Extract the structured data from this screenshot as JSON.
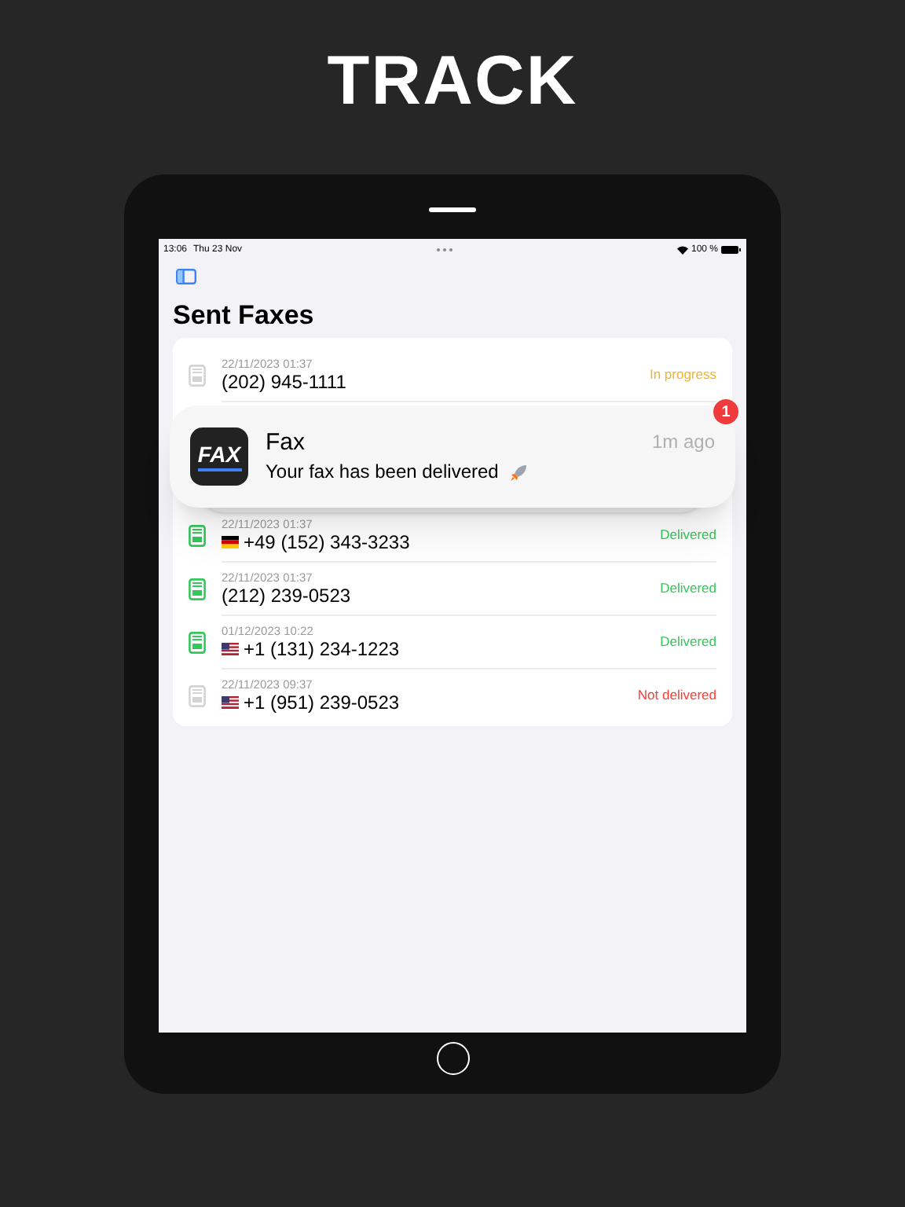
{
  "headline": "TRACK",
  "status_bar": {
    "time": "13:06",
    "date": "Thu 23 Nov",
    "battery": "100 %"
  },
  "title": "Sent Faxes",
  "faxes": [
    {
      "date": "22/11/2023 01:37",
      "number": "(202) 945-1111",
      "status": "In progress",
      "kind": "in_progress"
    },
    {
      "date": "22/11/2023 01:37",
      "number": "+49 (152) 343-3233",
      "status": "Delivered",
      "kind": "delivered",
      "flag": {
        "kind": "de"
      }
    },
    {
      "date": "22/11/2023 01:37",
      "number": "(212) 239-0523",
      "status": "Delivered",
      "kind": "delivered"
    },
    {
      "date": "01/12/2023 10:22",
      "number": "+1 (131) 234-1223",
      "status": "Delivered",
      "kind": "delivered",
      "flag": {
        "kind": "us"
      }
    },
    {
      "date": "22/11/2023 09:37",
      "number": "+1 (951) 239-0523",
      "status": "Not delivered",
      "kind": "not_delivered",
      "flag": {
        "kind": "us"
      }
    }
  ],
  "notification": {
    "app_icon_text": "FAX",
    "app": "Fax",
    "message": "Your fax has been delivered",
    "time": "1m ago",
    "badge": "1"
  }
}
